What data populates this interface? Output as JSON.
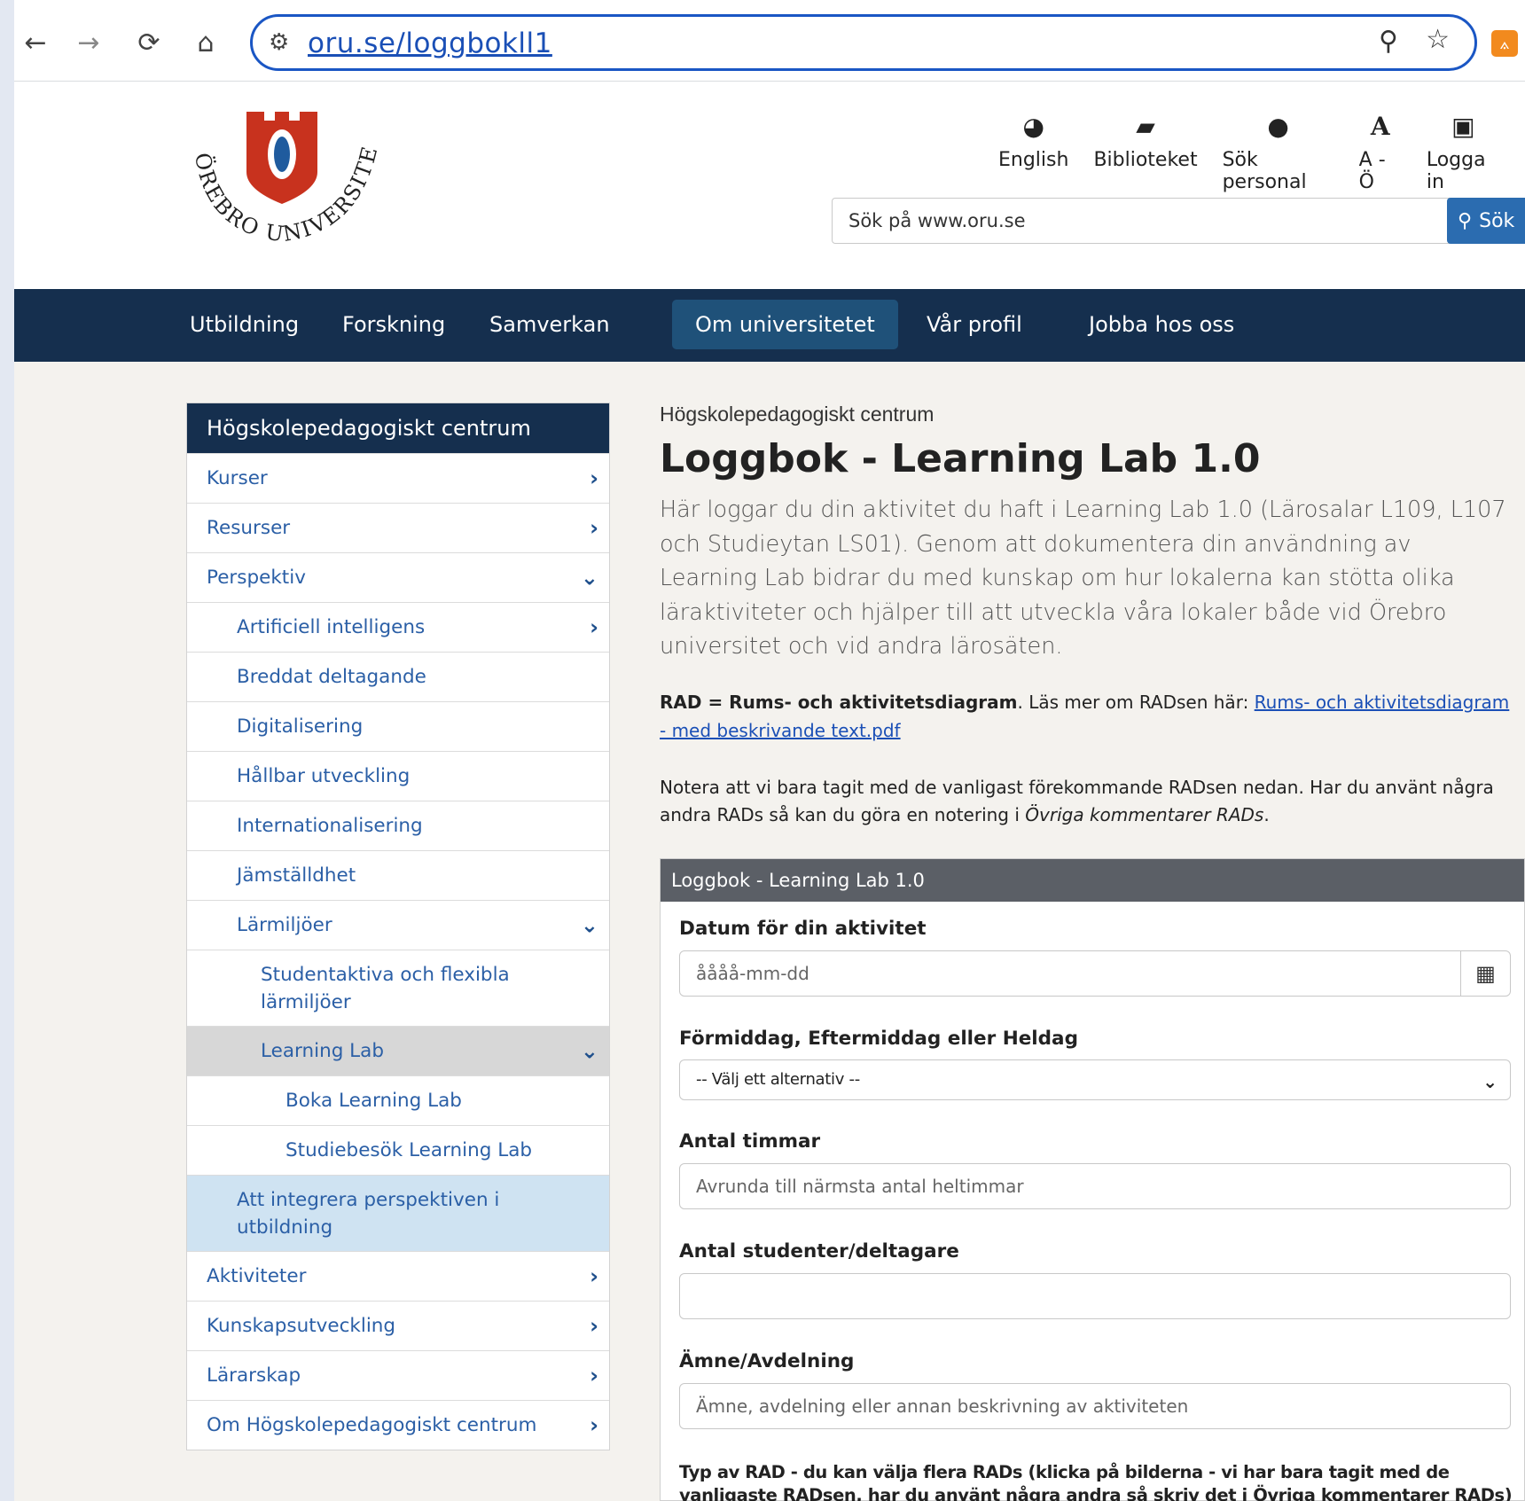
{
  "browser": {
    "url": "oru.se/loggbokll1",
    "back_icon": "←",
    "forward_icon": "→",
    "reload_icon": "⟳",
    "home_icon": "⌂",
    "site_settings_icon": "⚙",
    "zoom_icon": "⚲",
    "bookmark_icon": "☆",
    "rss_icon": "⟑"
  },
  "header": {
    "logo_text": "ÖREBRO UNIVERSITET",
    "top_links": [
      {
        "icon": "globe",
        "label": "English"
      },
      {
        "icon": "book",
        "label": "Biblioteket"
      },
      {
        "icon": "person",
        "label": "Sök personal"
      },
      {
        "icon": "letter-a",
        "label": "A - Ö"
      },
      {
        "icon": "lock",
        "label": "Logga in"
      }
    ],
    "search_placeholder": "Sök på www.oru.se",
    "search_button": "Sök"
  },
  "nav": {
    "items": [
      "Utbildning",
      "Forskning",
      "Samverkan",
      "Om universitetet",
      "Vår profil",
      "Jobba hos oss"
    ],
    "active": "Om universitetet"
  },
  "sidebar": {
    "title": "Högskolepedagogiskt centrum",
    "items": [
      {
        "label": "Kurser",
        "arrow": "›"
      },
      {
        "label": "Resurser",
        "arrow": "›"
      },
      {
        "label": "Perspektiv",
        "arrow": "⌄"
      },
      {
        "label": "Artificiell intelligens",
        "arrow": "›"
      },
      {
        "label": "Breddat deltagande",
        "arrow": ""
      },
      {
        "label": "Digitalisering",
        "arrow": ""
      },
      {
        "label": "Hållbar utveckling",
        "arrow": ""
      },
      {
        "label": "Internationalisering",
        "arrow": ""
      },
      {
        "label": "Jämställdhet",
        "arrow": ""
      },
      {
        "label": "Lärmiljöer",
        "arrow": "⌄"
      },
      {
        "label": "Studentaktiva och flexibla lärmiljöer",
        "arrow": ""
      },
      {
        "label": "Learning Lab",
        "arrow": "⌄"
      },
      {
        "label": "Boka Learning Lab",
        "arrow": ""
      },
      {
        "label": "Studiebesök Learning Lab",
        "arrow": ""
      },
      {
        "label": "Att integrera perspektiven i utbildning",
        "arrow": ""
      },
      {
        "label": "Aktiviteter",
        "arrow": "›"
      },
      {
        "label": "Kunskapsutveckling",
        "arrow": "›"
      },
      {
        "label": "Lärarskap",
        "arrow": "›"
      },
      {
        "label": "Om Högskolepedagogiskt centrum",
        "arrow": "›"
      }
    ]
  },
  "article": {
    "section": "Högskolepedagogiskt centrum",
    "title": "Loggbok - Learning Lab 1.0",
    "lead": "Här loggar du din aktivitet du haft i Learning Lab 1.0 (Lärosalar L109, L107 och Studieytan LS01). Genom att dokumentera din användning av Learning Lab bidrar du med kunskap om hur lokalerna kan stötta olika läraktiviteter och hjälper till att utveckla våra lokaler både vid Örebro universitet och vid andra lärosäten.",
    "rad_bold": "RAD = Rums- och aktivitetsdiagram",
    "rad_mid": ". Läs mer om RADsen här: ",
    "rad_link": "Rums- och aktivitetsdiagram - med beskrivande text.pdf",
    "note_start": "Notera att vi bara tagit med de vanligast förekommande RADsen nedan. Har du använt några andra RADs så kan du göra en notering i ",
    "note_italic": "Övriga kommentarer RADs",
    "note_end": "."
  },
  "form": {
    "title": "Loggbok - Learning Lab 1.0",
    "date_label": "Datum för din aktivitet",
    "date_placeholder": "åååå-mm-dd",
    "calendar_icon": "▦",
    "time_label": "Förmiddag, Eftermiddag eller Heldag",
    "time_select": "-- Välj ett alternativ --",
    "hours_label": "Antal timmar",
    "hours_placeholder": "Avrunda till närmsta antal heltimmar",
    "students_label": "Antal studenter/deltagare",
    "students_placeholder": "",
    "subject_label": "Ämne/Avdelning",
    "subject_placeholder": "Ämne, avdelning eller annan beskrivning av aktiviteten",
    "rad_label": "Typ av RAD - du kan välja flera RADs (klicka på bilderna - vi har bara tagit med de vanligaste RADsen, har du använt några andra så skriv det i Övriga kommentarer RADs)"
  }
}
